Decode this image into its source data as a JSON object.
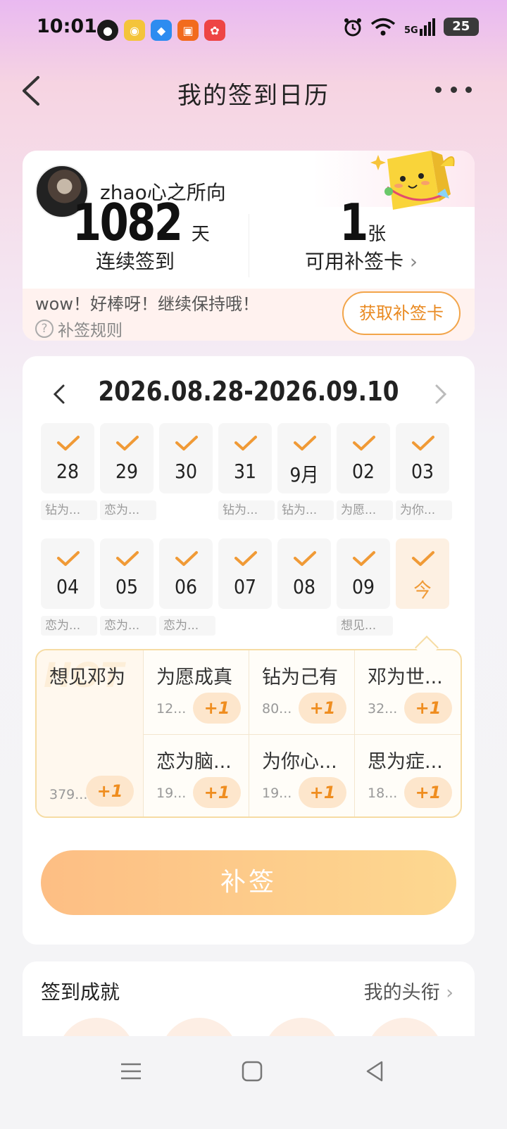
{
  "status_bar": {
    "time": "10:01",
    "network": "5G",
    "battery": "25"
  },
  "nav": {
    "title": "我的签到日历"
  },
  "summary": {
    "username": "zhao心之所向",
    "streak_days": "1082",
    "streak_unit": "天",
    "streak_label": "连续签到",
    "cards_count": "1",
    "cards_unit": "张",
    "cards_label": "可用补签卡",
    "encourage_text": "wow！好棒呀！继续保持哦！",
    "rules_label": "补签规则",
    "get_card_button": "获取补签卡"
  },
  "calendar": {
    "range": "2026.08.28-2026.09.10",
    "weeks": [
      [
        {
          "num": "28",
          "tag": "钻为..."
        },
        {
          "num": "29",
          "tag": "恋为..."
        },
        {
          "num": "30",
          "tag": ""
        },
        {
          "num": "31",
          "tag": "钻为..."
        },
        {
          "num": "9月",
          "tag": "钻为..."
        },
        {
          "num": "02",
          "tag": "为愿..."
        },
        {
          "num": "03",
          "tag": "为你..."
        }
      ],
      [
        {
          "num": "04",
          "tag": "恋为..."
        },
        {
          "num": "05",
          "tag": "恋为..."
        },
        {
          "num": "06",
          "tag": "恋为..."
        },
        {
          "num": "07",
          "tag": ""
        },
        {
          "num": "08",
          "tag": ""
        },
        {
          "num": "09",
          "tag": "想见..."
        },
        {
          "num": "今",
          "tag": ""
        }
      ]
    ]
  },
  "idols": {
    "main": {
      "name": "想见邓为",
      "count": "379...",
      "plus": "+1"
    },
    "cells": [
      {
        "name": "为愿成真",
        "count": "12...",
        "plus": "+1"
      },
      {
        "name": "钻为己有",
        "count": "80...",
        "plus": "+1"
      },
      {
        "name": "邓为世...",
        "count": "32...",
        "plus": "+1"
      },
      {
        "name": "恋为脑...",
        "count": "19...",
        "plus": "+1"
      },
      {
        "name": "为你心...",
        "count": "19...",
        "plus": "+1"
      },
      {
        "name": "思为症...",
        "count": "18...",
        "plus": "+1"
      }
    ]
  },
  "buqian_button": "补签",
  "achievements": {
    "title": "签到成就",
    "link": "我的头衔"
  },
  "colors": {
    "accent": "#f09a36",
    "button_gradient_start": "#fdbe84",
    "button_gradient_end": "#fdd890"
  }
}
